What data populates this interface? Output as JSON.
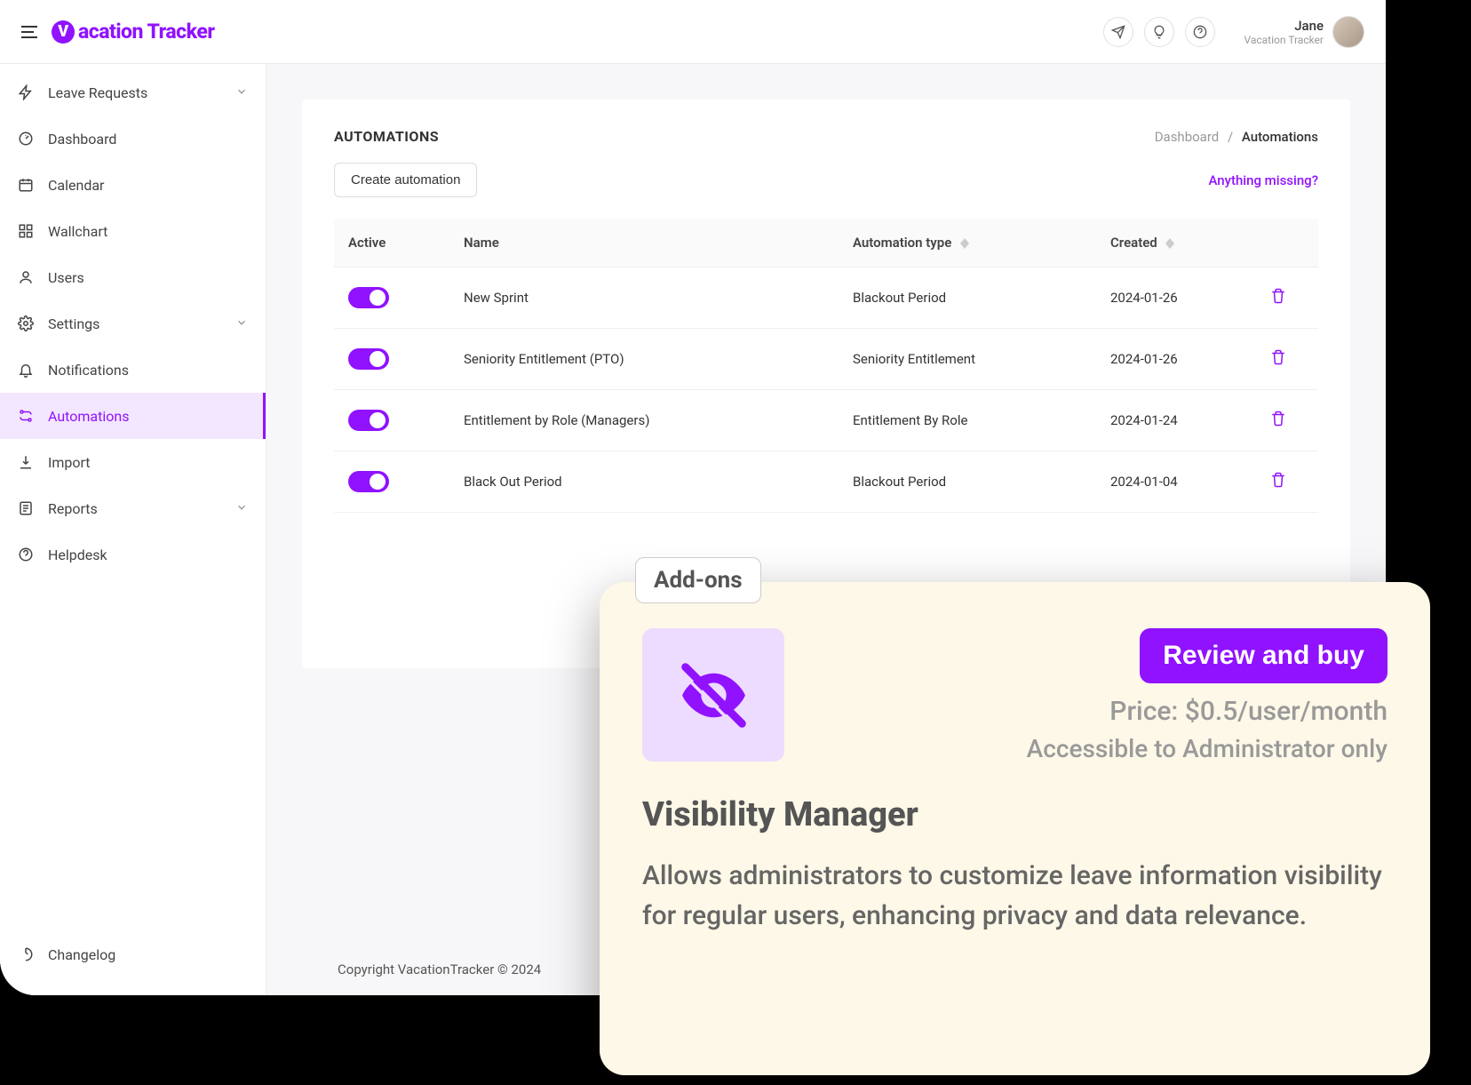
{
  "header": {
    "brand": "acation Tracker",
    "user_name": "Jane",
    "user_sub": "Vacation Tracker"
  },
  "sidebar": {
    "items": [
      {
        "label": "Leave Requests",
        "expandable": true,
        "active": false
      },
      {
        "label": "Dashboard",
        "expandable": false,
        "active": false
      },
      {
        "label": "Calendar",
        "expandable": false,
        "active": false
      },
      {
        "label": "Wallchart",
        "expandable": false,
        "active": false
      },
      {
        "label": "Users",
        "expandable": false,
        "active": false
      },
      {
        "label": "Settings",
        "expandable": true,
        "active": false
      },
      {
        "label": "Notifications",
        "expandable": false,
        "active": false
      },
      {
        "label": "Automations",
        "expandable": false,
        "active": true
      },
      {
        "label": "Import",
        "expandable": false,
        "active": false
      },
      {
        "label": "Reports",
        "expandable": true,
        "active": false
      },
      {
        "label": "Helpdesk",
        "expandable": false,
        "active": false
      }
    ],
    "changelog": "Changelog"
  },
  "page": {
    "title": "AUTOMATIONS",
    "crumb_root": "Dashboard",
    "crumb_current": "Automations",
    "create_btn": "Create automation",
    "missing_link": "Anything missing?"
  },
  "table": {
    "headers": {
      "active": "Active",
      "name": "Name",
      "type": "Automation type",
      "created": "Created"
    },
    "rows": [
      {
        "active": true,
        "name": "New Sprint",
        "type": "Blackout Period",
        "created": "2024-01-26"
      },
      {
        "active": true,
        "name": "Seniority Entitlement (PTO)",
        "type": "Seniority Entitlement",
        "created": "2024-01-26"
      },
      {
        "active": true,
        "name": "Entitlement by Role (Managers)",
        "type": "Entitlement By Role",
        "created": "2024-01-24"
      },
      {
        "active": true,
        "name": "Black Out Period",
        "type": "Blackout Period",
        "created": "2024-01-04"
      }
    ]
  },
  "footer": {
    "copyright": "Copyright VacationTracker © 2024"
  },
  "addon": {
    "badge": "Add-ons",
    "buy_btn": "Review and buy",
    "price": "Price: $0.5/user/month",
    "access": "Accessible to Administrator only",
    "title": "Visibility Manager",
    "desc": "Allows administrators to customize leave information visibility for regular users, enhancing privacy and data relevance."
  }
}
